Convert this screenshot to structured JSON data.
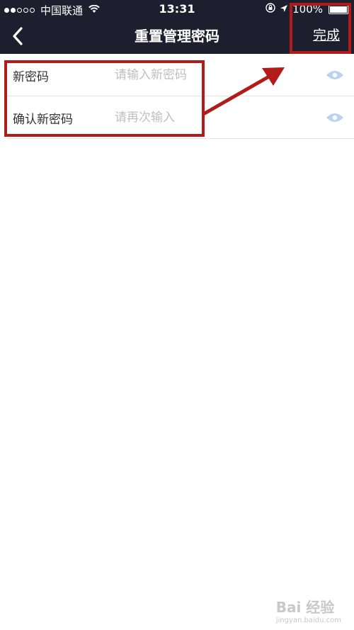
{
  "status_bar": {
    "carrier": "中国联通",
    "time": "13:31",
    "battery": "100%"
  },
  "nav": {
    "title": "重置管理密码",
    "done_label": "完成"
  },
  "form": {
    "fields": [
      {
        "label": "新密码",
        "placeholder": "请输入新密码"
      },
      {
        "label": "确认新密码",
        "placeholder": "请再次输入"
      }
    ]
  },
  "icons": {
    "back": "chevron-left-icon",
    "eye": "eye-icon",
    "wifi": "wifi-icon",
    "location": "location-arrow-icon",
    "rotation_lock": "rotation-lock-icon"
  },
  "colors": {
    "header_bg": "#1d1e2e",
    "annotation": "#b31b1b",
    "eye_icon": "#b8d4f0"
  },
  "watermark": {
    "brand": "Bai 经验",
    "url": "jingyan.baidu.com"
  }
}
